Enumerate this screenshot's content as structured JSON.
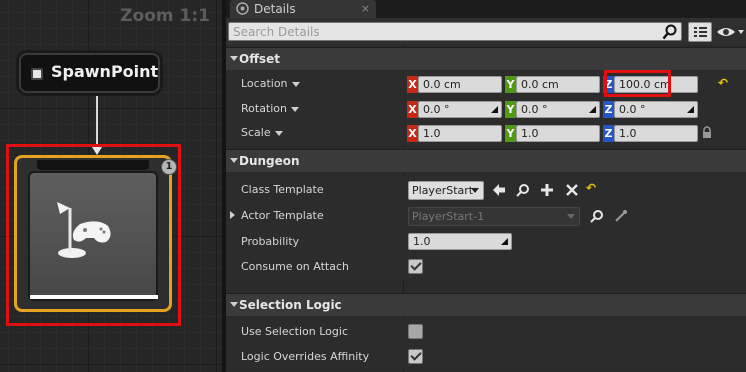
{
  "graph": {
    "zoom_label": "Zoom 1:1",
    "spawn_node_label": "SpawnPoint",
    "room_node_badge": "1"
  },
  "details_tab": {
    "label": "Details",
    "close": "×"
  },
  "search": {
    "placeholder": "Search Details"
  },
  "offset": {
    "category": "Offset",
    "location": {
      "label": "Location",
      "x": "0.0 cm",
      "y": "0.0 cm",
      "z": "100.0 cm"
    },
    "rotation": {
      "label": "Rotation",
      "x": "0.0 °",
      "y": "0.0 °",
      "z": "0.0 °"
    },
    "scale": {
      "label": "Scale",
      "x": "1.0",
      "y": "1.0",
      "z": "1.0"
    },
    "axis": {
      "x": "X",
      "y": "Y",
      "z": "Z"
    }
  },
  "dungeon": {
    "category": "Dungeon",
    "class_template": {
      "label": "Class Template",
      "value": "PlayerStart"
    },
    "actor_template": {
      "label": "Actor Template",
      "value": "PlayerStart-1"
    },
    "probability": {
      "label": "Probability",
      "value": "1.0"
    },
    "consume_on_attach": {
      "label": "Consume on Attach",
      "checked": true
    }
  },
  "selection_logic": {
    "category": "Selection Logic",
    "use_selection_logic": {
      "label": "Use Selection Logic",
      "checked": false
    },
    "logic_overrides_affinity": {
      "label": "Logic Overrides Affinity",
      "checked": true
    }
  },
  "colors": {
    "axis_x": "#c52a17",
    "axis_y": "#4f9a15",
    "axis_z": "#2456c8",
    "node_selected_border": "#e6a321",
    "highlight": "#e01010",
    "reset_arrow": "#e6c200"
  },
  "icons": [
    "details-tab-icon",
    "search-icon",
    "grid-view-icon",
    "eye-icon",
    "browse-arrow-icon",
    "magnifier-icon",
    "add-icon",
    "clear-icon",
    "reset-arrow-icon",
    "lock-icon",
    "eyedropper-icon",
    "player-start-icon"
  ]
}
